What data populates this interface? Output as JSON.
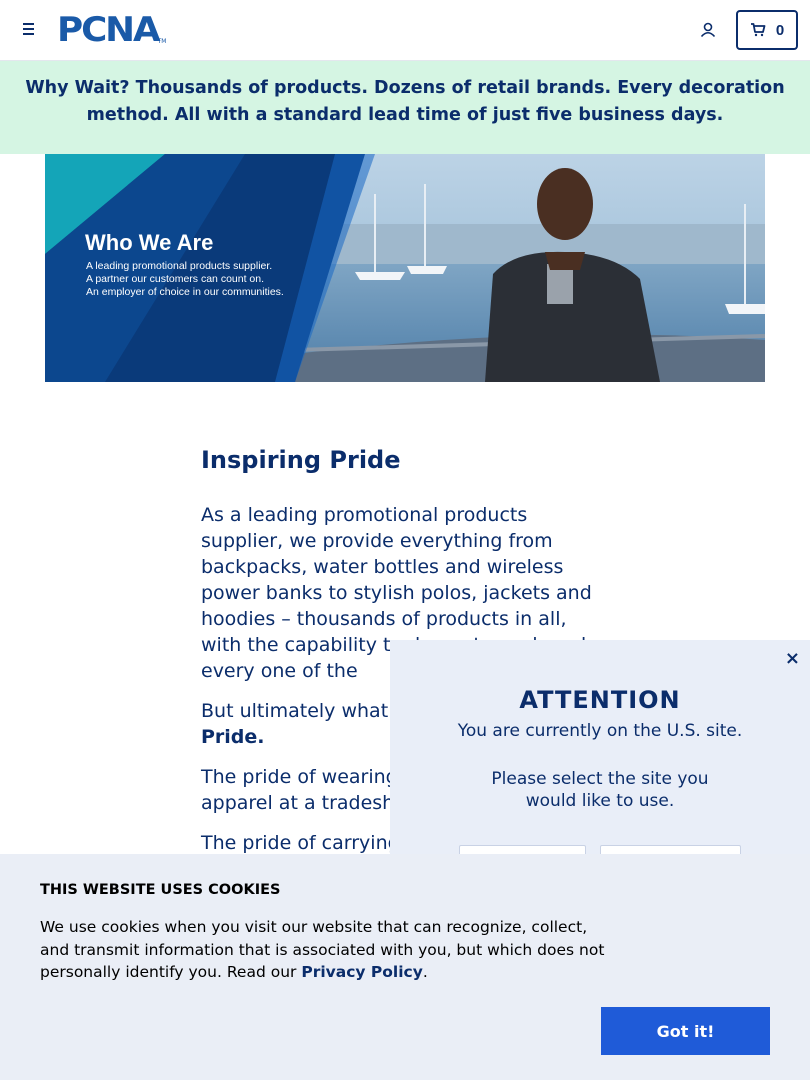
{
  "header": {
    "logo_text": "PCNA",
    "logo_tm": "TM",
    "cart_count": "0"
  },
  "promo": {
    "lead": "Why Wait?",
    "text": " Thousands of products. Dozens of retail brands. Every decoration method. All with a standard lead time of just five business days."
  },
  "banner": {
    "title": "Who We Are",
    "lines": [
      "A leading promotional products supplier.",
      "A partner our customers can count on.",
      "An employer of choice in our communities."
    ]
  },
  "content": {
    "title": "Inspiring Pride",
    "p1": "As a leading promotional products supplier, we provide everything from backpacks, water bottles and wireless power banks to stylish polos, jackets and hoodies – thousands of products in all, with the capability to decorate each and every one of the",
    "p2_start": "But ultimately what",
    "p2_bold": "Pride.",
    "p3": "The pride of wearing",
    "p3_line2": "apparel at a tradesh",
    "p4": "The pride of carrying"
  },
  "modal": {
    "close": "×",
    "title": "ATTENTION",
    "text": "You are currently on the U.S. site.",
    "prompt_line1": "Please select the site you",
    "prompt_line2": "would like to use."
  },
  "cookie": {
    "title": "THIS WEBSITE USES COOKIES",
    "text": "We use cookies when you visit our website that can recognize, collect, and transmit information that is associated with you, but which does not personally identify you. Read our ",
    "link": "Privacy Policy",
    "period": ".",
    "button": "Got it!"
  },
  "colors": {
    "navy": "#0b2d6b",
    "promo_bg": "#d5f5e3",
    "button_blue": "#1f5bd8",
    "modal_bg": "#e9eef8"
  }
}
